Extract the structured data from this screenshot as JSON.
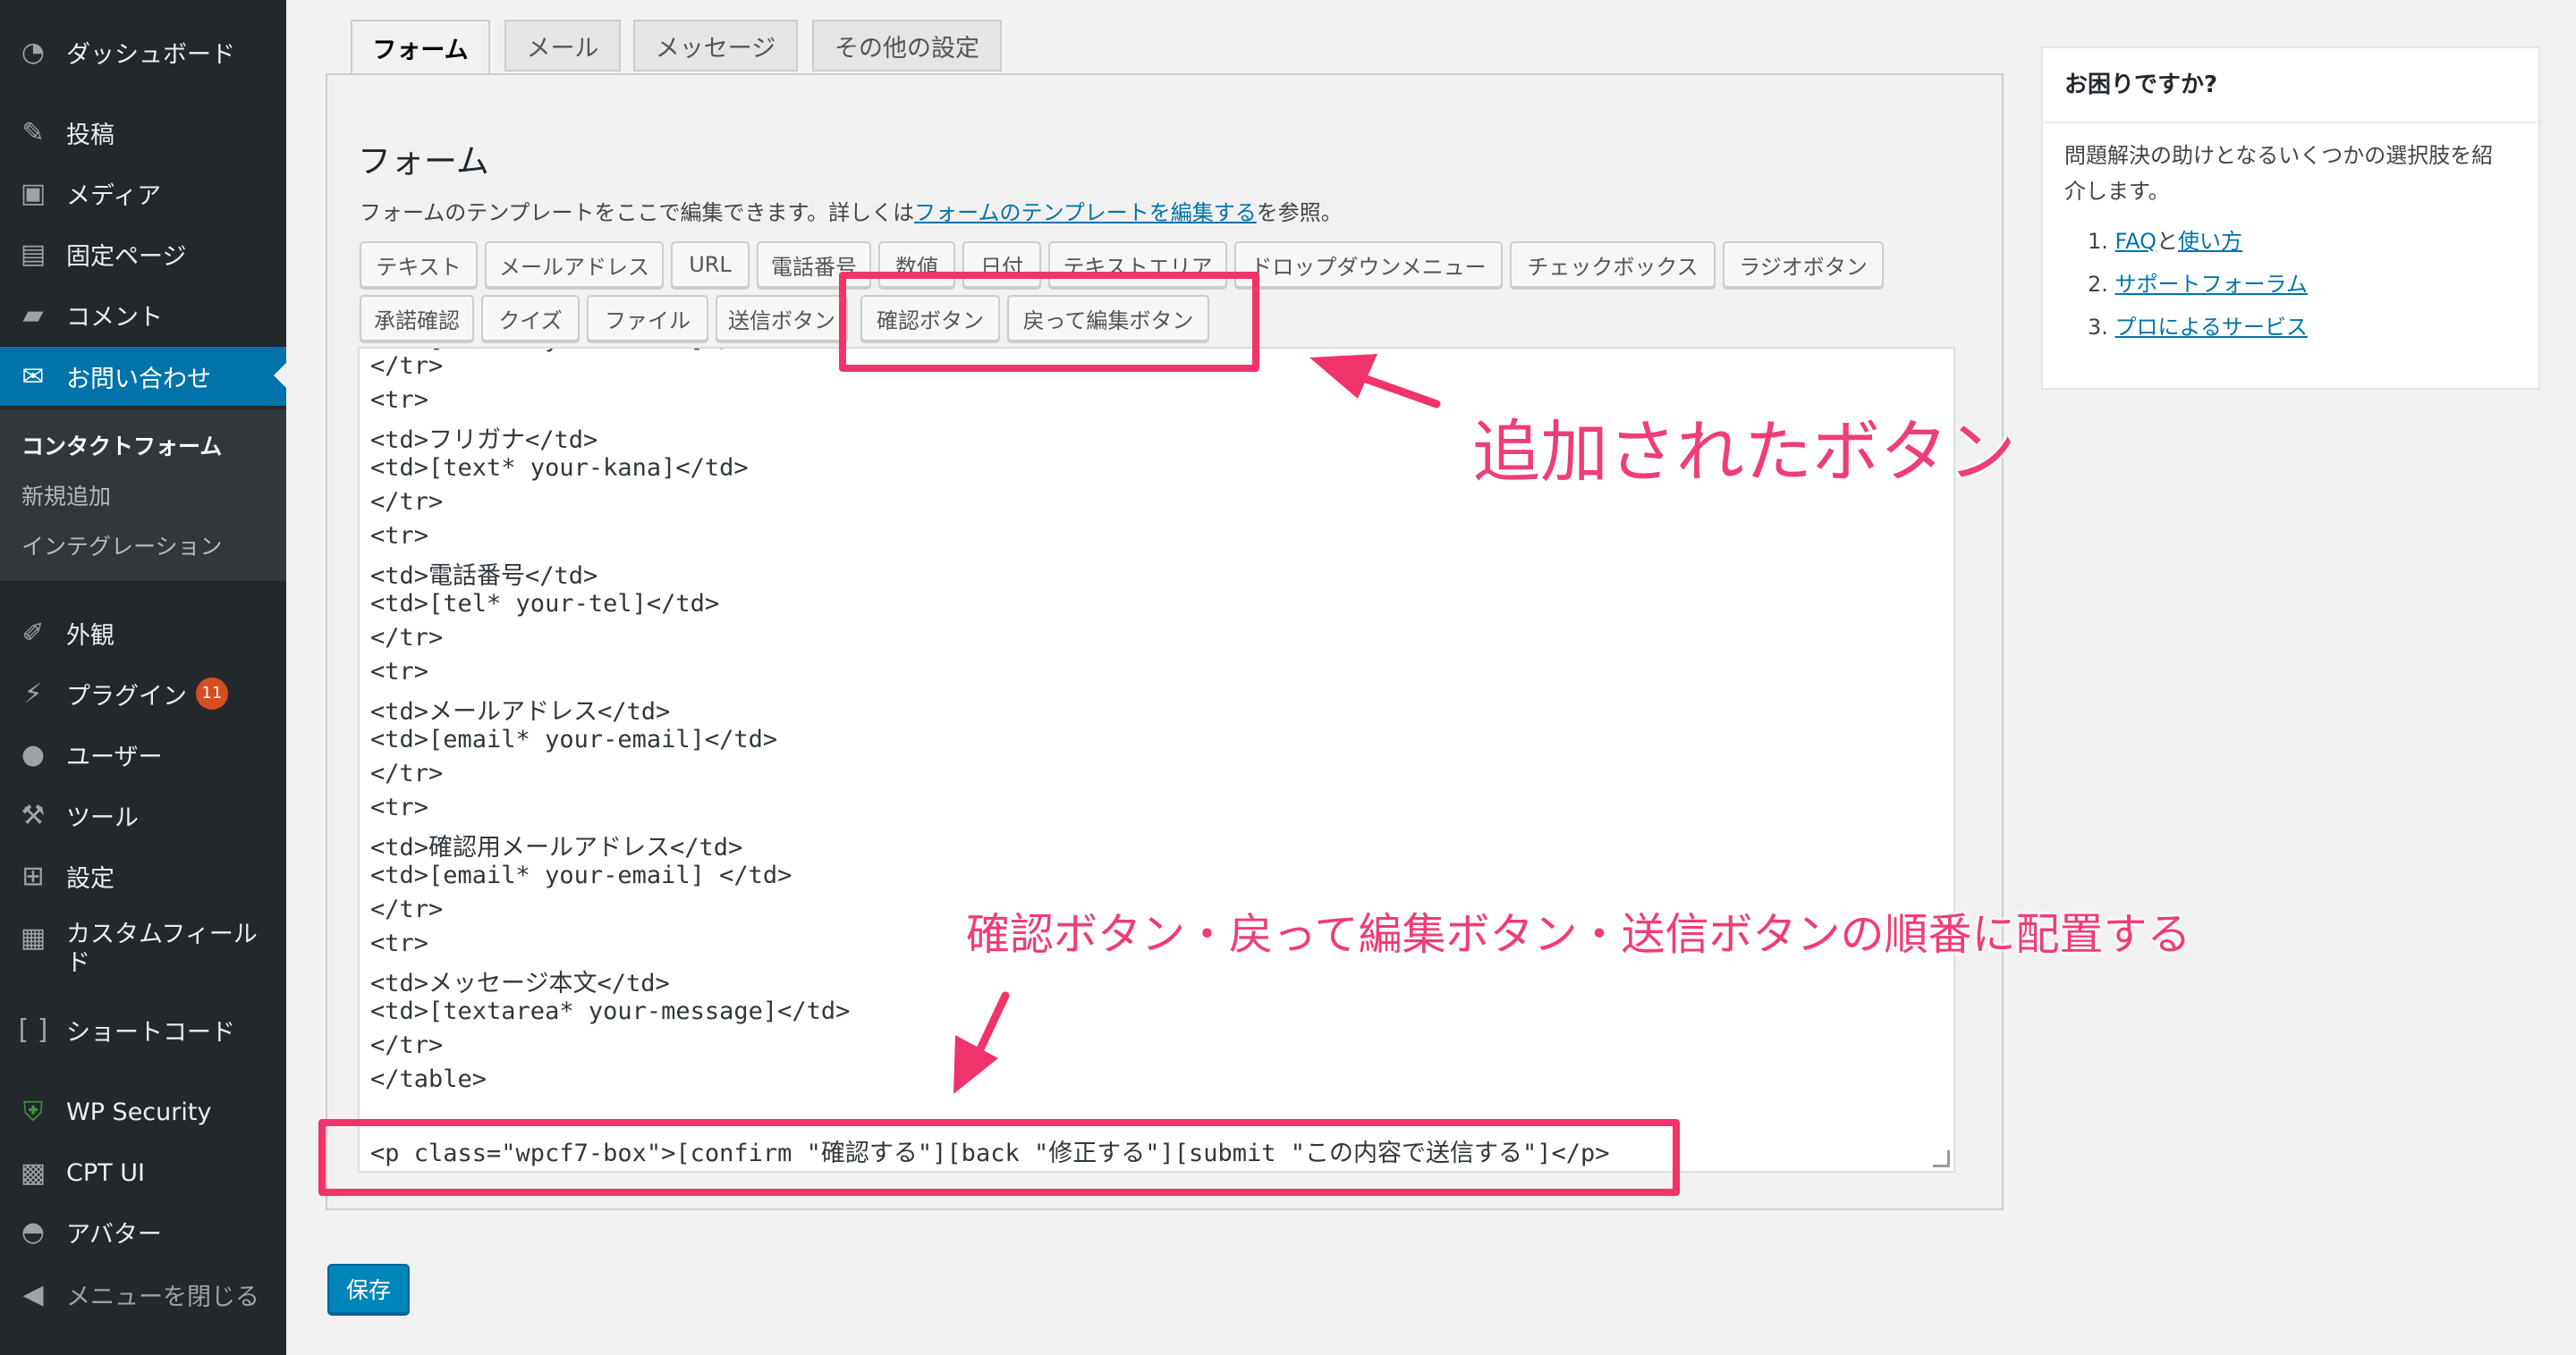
{
  "sidebar": {
    "dashboard": "ダッシュボード",
    "posts": "投稿",
    "media": "メディア",
    "pages": "固定ページ",
    "comments": "コメント",
    "contact": "お問い合わせ",
    "submenu": {
      "contact_form": "コンタクトフォーム",
      "add_new": "新規追加",
      "integration": "インテグレーション"
    },
    "appearance": "外観",
    "plugins": "プラグイン",
    "plugins_badge": "11",
    "users": "ユーザー",
    "tools": "ツール",
    "settings": "設定",
    "custom_fields": "カスタムフィールド",
    "shortcode": "ショートコード",
    "wp_security": "WP Security",
    "cpt_ui": "CPT UI",
    "avatar": "アバター",
    "collapse": "メニューを閉じる"
  },
  "tabs": {
    "form": "フォーム",
    "mail": "メール",
    "messages": "メッセージ",
    "other": "その他の設定"
  },
  "panel": {
    "heading": "フォーム",
    "desc_before": "フォームのテンプレートをここで編集できます。詳しくは",
    "desc_link": "フォームのテンプレートを編集する",
    "desc_after": "を参照。"
  },
  "tag_buttons": {
    "text": "テキスト",
    "email": "メールアドレス",
    "url": "URL",
    "tel": "電話番号",
    "number": "数値",
    "date": "日付",
    "textarea": "テキストエリア",
    "dropdown": "ドロップダウンメニュー",
    "checkbox": "チェックボックス",
    "radio": "ラジオボタン",
    "acceptance": "承諾確認",
    "quiz": "クイズ",
    "file": "ファイル",
    "submit": "送信ボタン",
    "confirm": "確認ボタン",
    "back": "戻って編集ボタン"
  },
  "code_lines": [
    "</tr>",
    "<tr>",
    "<td>フリガナ</td>",
    "<td>[text* your-kana]</td>",
    "</tr>",
    "<tr>",
    "<td>電話番号</td>",
    "<td>[tel* your-tel]</td>",
    "</tr>",
    "<tr>",
    "<td>メールアドレス</td>",
    "<td>[email* your-email]</td>",
    "</tr>",
    "<tr>",
    "<td>確認用メールアドレス</td>",
    "<td>[email* your-email] </td>",
    "</tr>",
    "<tr>",
    "<td>メッセージ本文</td>",
    "<td>[textarea* your-message]</td>",
    "</tr>",
    "</table>",
    "",
    "<p class=\"wpcf7-box\">[confirm \"確認する\"][back \"修正する\"][submit \"この内容で送信する\"]</p>"
  ],
  "save_button": "保存",
  "help": {
    "title": "お困りですか?",
    "body": "問題解決の助けとなるいくつかの選択肢を紹介します。",
    "item1_link_a": "FAQ",
    "item1_mid": "と",
    "item1_link_b": "使い方",
    "item2_link": "サポートフォーラム",
    "item3_link": "プロによるサービス",
    "num1": "1.",
    "num2": "2.",
    "num3": "3."
  },
  "annotations": {
    "added_buttons": "追加されたボタン",
    "order_note": "確認ボタン・戻って編集ボタン・送信ボタンの順番に配置する",
    "color": "#f0336b"
  }
}
